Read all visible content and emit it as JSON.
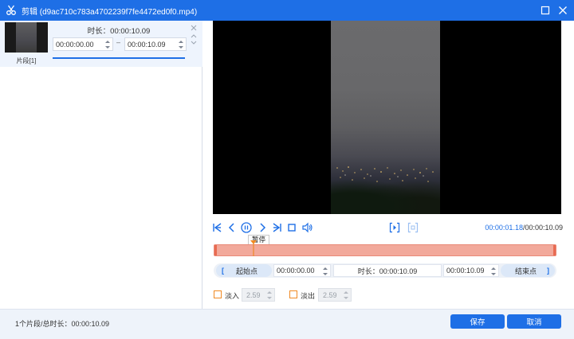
{
  "window": {
    "title": "剪辑 (d9ac710c783a4702239f7fe4472ed0f0.mp4)",
    "icons": {
      "app": "scissors-icon",
      "maximize": "maximize-icon",
      "close": "close-icon"
    }
  },
  "clip_list": {
    "items": [
      {
        "label": "片段[1]",
        "duration_text": "时长：00:00:10.09",
        "start": "00:00:00.00",
        "end": "00:00:10.09",
        "separator": "–"
      }
    ]
  },
  "player": {
    "icons": [
      "skip-to-start-icon",
      "prev-frame-icon",
      "pause-icon",
      "next-frame-icon",
      "skip-to-end-icon",
      "stop-icon",
      "volume-icon",
      "mark-in-icon",
      "mark-out-icon"
    ],
    "tooltip": "暂停",
    "current_time": "00:00:01.18",
    "total_time": "/00:00:10.09"
  },
  "timeline": {
    "playhead_fraction": 0.117,
    "selection_start_fraction": 0.0,
    "selection_end_fraction": 1.0,
    "colors": {
      "selection": "#f2a99b",
      "handle": "#e86b52",
      "playhead": "#f08a24"
    }
  },
  "range": {
    "start_label": "起始点",
    "start_value": "00:00:00.00",
    "duration_text": "时长：00:00:10.09",
    "end_value": "00:00:10.09",
    "end_label": "结束点",
    "bracket_open": "[",
    "bracket_close": "]"
  },
  "fade": {
    "fade_in_label": "淡入",
    "fade_in_value": "2.59",
    "fade_out_label": "淡出",
    "fade_out_value": "2.59",
    "fade_in_checked": false,
    "fade_out_checked": false
  },
  "footer": {
    "summary": "1个片段/总时长：00:00:10.09",
    "save_label": "保存",
    "cancel_label": "取消"
  },
  "colors": {
    "accent": "#1e6fe6",
    "checkbox": "#f08a24"
  }
}
